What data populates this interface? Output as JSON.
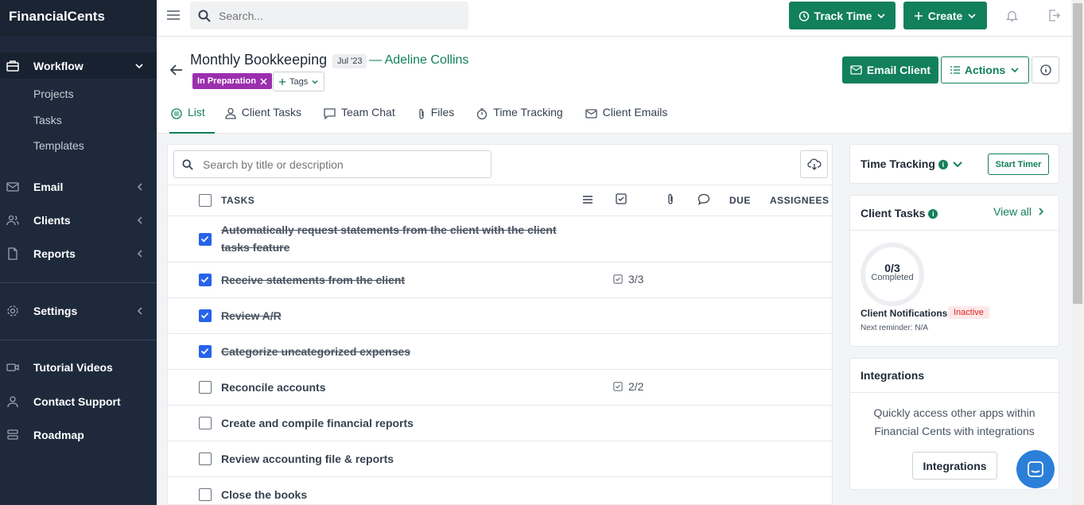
{
  "app": {
    "logo": "FinancialCents"
  },
  "sidebar": {
    "workflow": "Workflow",
    "sub": [
      "Projects",
      "Tasks",
      "Templates"
    ],
    "items": [
      {
        "label": "Email",
        "icon": "mail-icon"
      },
      {
        "label": "Clients",
        "icon": "users-icon"
      },
      {
        "label": "Reports",
        "icon": "file-icon"
      }
    ],
    "settings": "Settings",
    "bottom": [
      "Tutorial Videos",
      "Contact Support",
      "Roadmap"
    ]
  },
  "topbar": {
    "search_placeholder": "Search...",
    "track_time": "Track Time",
    "create": "Create"
  },
  "project": {
    "title": "Monthly Bookkeeping",
    "date": "Jul '23",
    "client": "— Adeline Collins",
    "status": "In Preparation",
    "tags": "Tags",
    "email_client": "Email Client",
    "actions": "Actions"
  },
  "tabs": [
    "List",
    "Client Tasks",
    "Team Chat",
    "Files",
    "Time Tracking",
    "Client Emails"
  ],
  "tasks": {
    "search_placeholder": "Search by title or description",
    "headers": {
      "tasks": "TASKS",
      "due": "DUE",
      "assignees": "ASSIGNEES"
    },
    "rows": [
      {
        "line1": "Automatically request statements from the client with the client",
        "line2": "tasks feature",
        "done": true,
        "sub": ""
      },
      {
        "line1": "Receive statements from the client",
        "done": true,
        "sub": "3/3"
      },
      {
        "line1": "Review A/R",
        "done": true,
        "sub": ""
      },
      {
        "line1": "Categorize uncategorized expenses",
        "done": true,
        "sub": ""
      },
      {
        "line1": "Reconcile accounts",
        "done": false,
        "sub": "2/2"
      },
      {
        "line1": "Create and compile financial reports",
        "done": false,
        "sub": ""
      },
      {
        "line1": "Review accounting file & reports",
        "done": false,
        "sub": ""
      },
      {
        "line1": "Close the books",
        "done": false,
        "sub": ""
      }
    ]
  },
  "time_tracking": {
    "title": "Time Tracking",
    "start": "Start Timer"
  },
  "client_tasks": {
    "title": "Client Tasks",
    "view_all": "View all",
    "count": "0/3",
    "completed": "Completed",
    "notifications": "Client Notifications",
    "status": "Inactive",
    "reminder": "Next reminder: N/A"
  },
  "integrations": {
    "title": "Integrations",
    "text1": "Quickly access other apps within",
    "text2": "Financial Cents with integrations",
    "button": "Integrations"
  },
  "colors": {
    "brand": "#12805c",
    "sidebar": "#1e2a3b",
    "status": "#9b2fae",
    "check": "#2563eb"
  }
}
